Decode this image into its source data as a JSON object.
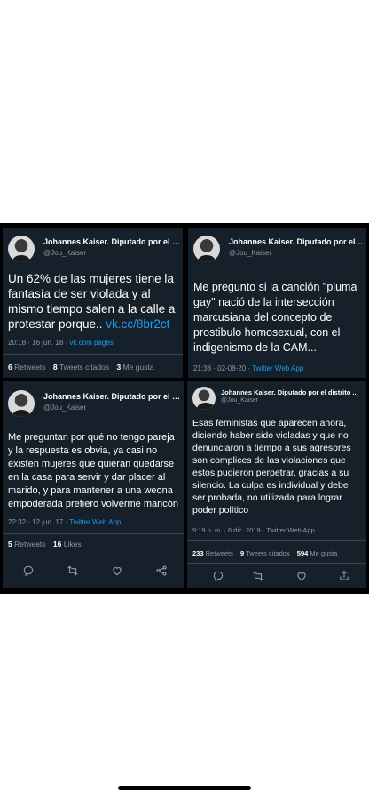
{
  "tweets": [
    {
      "display_name": "Johannes Kaiser. Diputado por el d...",
      "handle": "@Jou_Kaiser",
      "text": "Un 62% de las mujeres tiene la fantasía de ser violada y al mismo tiempo salen a la calle a protestar porque.. ",
      "link": "vk.cc/8br2ct",
      "timestamp": "20:18 · 16 jun. 18 · ",
      "source": "vk.com pages",
      "retweets": "6",
      "retweets_label": "Retweets",
      "quotes": "8",
      "quotes_label": "Tweets citados",
      "likes": "3",
      "likes_label": "Me gusta"
    },
    {
      "display_name": "Johannes Kaiser. Diputado por el di...",
      "handle": "@Jou_Kaiser",
      "text": "Me pregunto si la canción \"pluma gay\" nació de la intersección marcusiana del concepto de prostibulo homosexual, con el indigenismo de la CAM...",
      "timestamp": "21:38 · 02-08-20 · ",
      "source": "Twitter Web App"
    },
    {
      "display_name": "Johannes Kaiser. Diputado por el d...",
      "handle": "@Jou_Kaiser",
      "text": "Me preguntan por qué no tengo pareja y la respuesta es obvia, ya casi no existen mujeres que quieran quedarse en la casa para servir y dar placer al marido, y para mantener a una weona empoderada prefiero volverme maricón",
      "timestamp": "22:32 · 12 jun. 17 · ",
      "source": "Twitter Web App",
      "retweets": "5",
      "retweets_label": "Retweets",
      "likes": "16",
      "likes_label": "Likes"
    },
    {
      "display_name": "Johannes Kaiser. Diputado por el distrito ...",
      "handle": "@Jou_Kaiser",
      "text": "Esas feministas que aparecen ahora, diciendo haber sido violadas y que no denunciaron a tiempo a sus agresores son complices de las violaciones que estos pudieron perpetrar, gracias a su silencio. La culpa es individual y debe ser probada, no utilizada para lograr poder político",
      "timestamp": "9:19 p. m. · 6 dic. 2019 · ",
      "source": "Twitter Web App",
      "retweets": "233",
      "retweets_label": "Retweets",
      "quotes": "9",
      "quotes_label": "Tweets citados",
      "likes": "594",
      "likes_label": "Me gusta"
    }
  ],
  "icons": {
    "reply": "reply-icon",
    "retweet": "retweet-icon",
    "like": "heart-icon",
    "share": "share-icon"
  },
  "colors": {
    "card_bg": "#15202b",
    "link": "#1d9bf0",
    "muted": "#8b98a5"
  }
}
